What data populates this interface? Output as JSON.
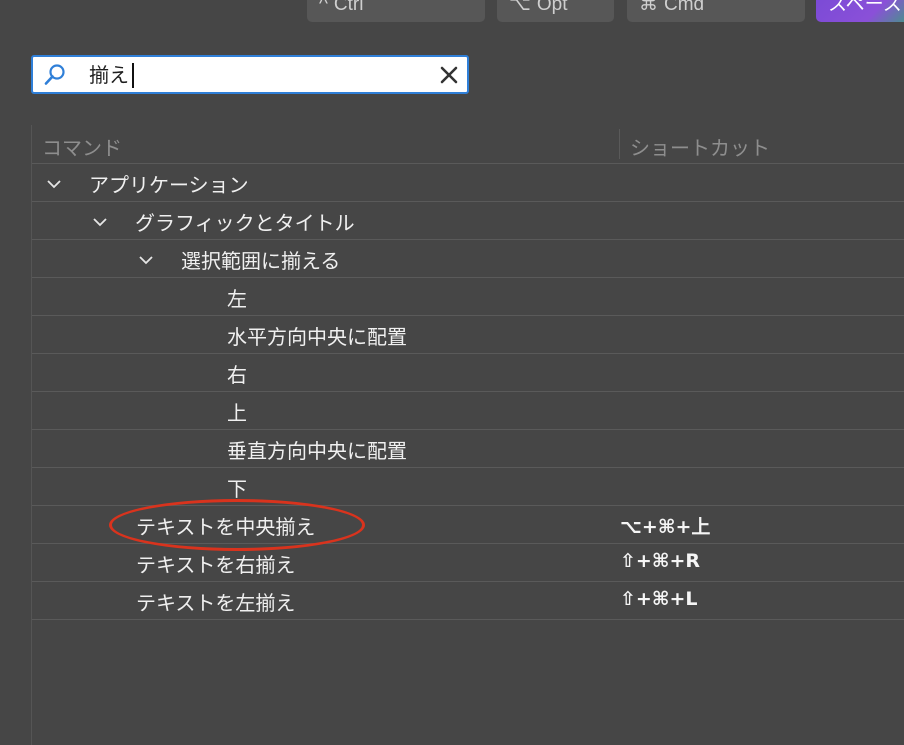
{
  "modifier_keys": [
    {
      "glyph": "^",
      "label": "Ctrl"
    },
    {
      "glyph": "⌥",
      "label": "Opt"
    },
    {
      "glyph": "⌘",
      "label": "Cmd"
    },
    {
      "glyph": "",
      "label": "スペース"
    }
  ],
  "search": {
    "value": "揃え",
    "icon": "search-icon",
    "clear_icon": "close-icon"
  },
  "table": {
    "headers": {
      "command": "コマンド",
      "shortcut": "ショートカット"
    },
    "rows": [
      {
        "label": "アプリケーション",
        "shortcut": "",
        "expanded": true
      },
      {
        "label": "グラフィックとタイトル",
        "shortcut": "",
        "expanded": true
      },
      {
        "label": "選択範囲に揃える",
        "shortcut": "",
        "expanded": true
      },
      {
        "label": "左",
        "shortcut": ""
      },
      {
        "label": "水平方向中央に配置",
        "shortcut": ""
      },
      {
        "label": "右",
        "shortcut": ""
      },
      {
        "label": "上",
        "shortcut": ""
      },
      {
        "label": "垂直方向中央に配置",
        "shortcut": ""
      },
      {
        "label": "下",
        "shortcut": ""
      },
      {
        "label": "テキストを中央揃え",
        "shortcut": "⌥+⌘+上",
        "highlighted": true
      },
      {
        "label": "テキストを右揃え",
        "shortcut": "⇧+⌘+R"
      },
      {
        "label": "テキストを左揃え",
        "shortcut": "⇧+⌘+L"
      }
    ]
  },
  "colors": {
    "background": "#464646",
    "search_border": "#2f7fd8",
    "highlight_ring": "#d9331d",
    "workspace_key": "#7a4ad6"
  }
}
